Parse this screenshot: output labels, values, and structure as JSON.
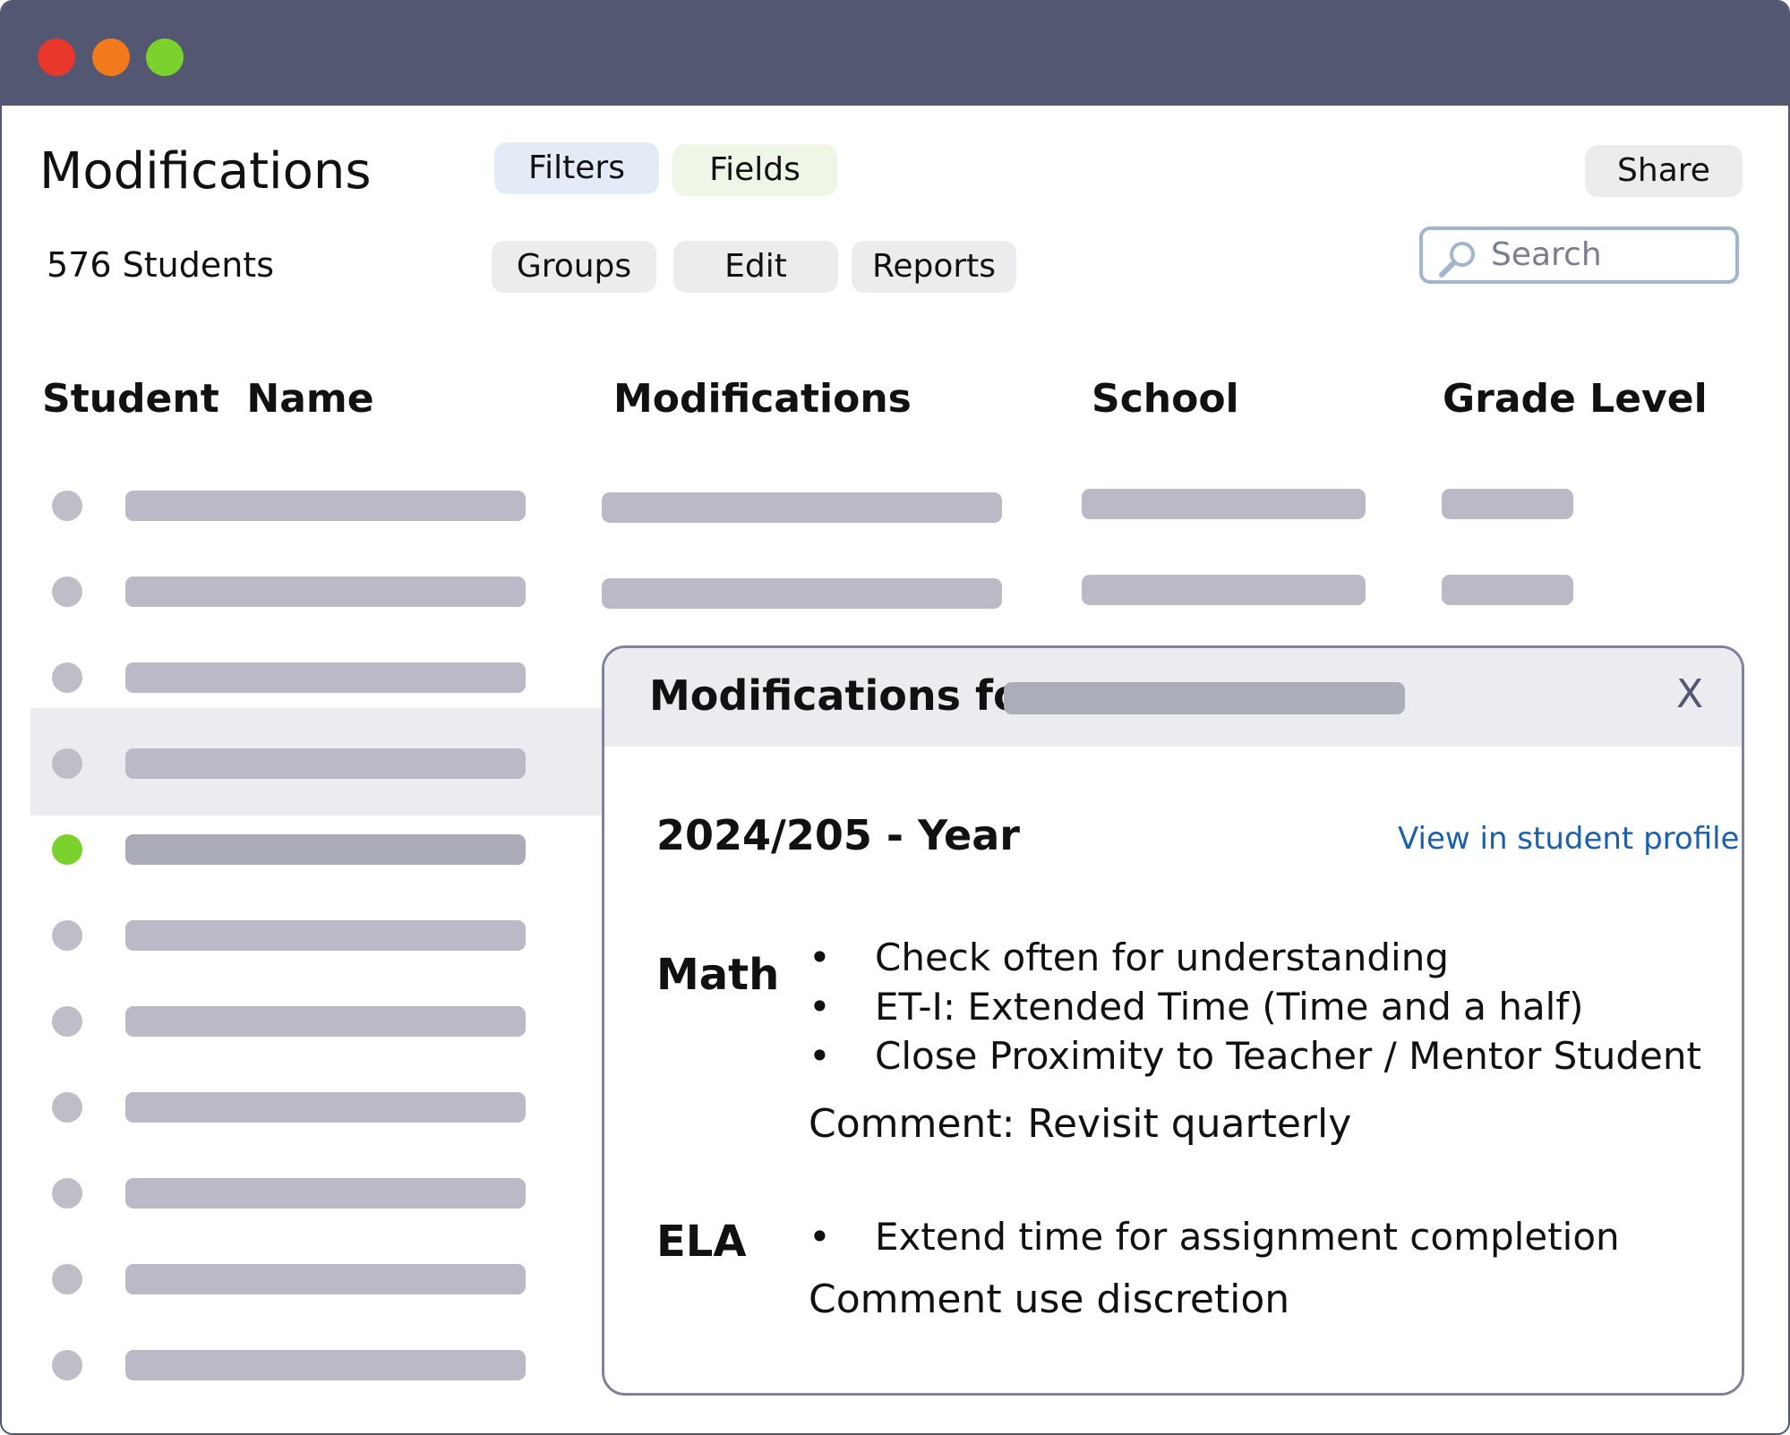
{
  "page": {
    "title": "Modifications",
    "student_count": "576 Students"
  },
  "toolbar": {
    "filters": "Filters",
    "fields": "Fields",
    "share": "Share",
    "groups": "Groups",
    "edit": "Edit",
    "reports": "Reports"
  },
  "search": {
    "placeholder": "Search",
    "icon": "magnifier-icon"
  },
  "table": {
    "headers": [
      "Student  Name",
      "Modifications",
      "School",
      "Grade Level"
    ],
    "row_count": 11,
    "selected_row": 4
  },
  "colors": {
    "titlebar": "#545772",
    "close_dot": "#e8382c",
    "minimize_dot": "#f27a1c",
    "zoom_dot": "#7bd22c",
    "selected_dot": "#7bd22c",
    "link": "#1c5fab"
  },
  "modal": {
    "title": "Modifications for",
    "close": "X",
    "year": "2024/205 - Year",
    "profile_link": "View in student profile",
    "subjects": [
      {
        "name": "Math",
        "items": [
          "Check often for understanding",
          "ET-I: Extended Time (Time and a half)",
          "Close Proximity to Teacher / Mentor Student"
        ],
        "comment": "Comment: Revisit quarterly"
      },
      {
        "name": "ELA",
        "items": [
          "Extend time for assignment completion"
        ],
        "comment": "Comment use discretion"
      }
    ],
    "bullet": "•"
  }
}
